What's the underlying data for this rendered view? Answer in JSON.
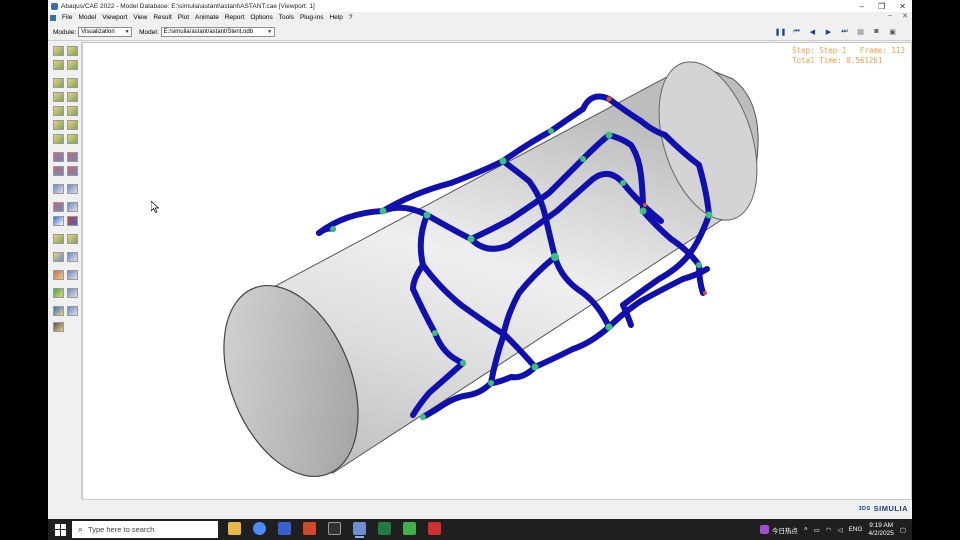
{
  "window": {
    "title": "Abaqus/CAE 2022 - Model Database: E:\\simulia\\astant\\astant\\ASTANT.cae [Viewport: 1]",
    "minimize": "–",
    "maximize": "❐",
    "close": "✕"
  },
  "menu": {
    "items": [
      "File",
      "Model",
      "Viewport",
      "View",
      "Result",
      "Plot",
      "Animate",
      "Report",
      "Options",
      "Tools",
      "Plug-ins",
      "Help",
      "?"
    ],
    "right_min": "–",
    "right_close": "✕"
  },
  "context": {
    "module_label": "Module:",
    "module_value": "Visualization",
    "model_label": "Model:",
    "model_value": "E:/simulia/astant/astant/Stent.odb"
  },
  "animation": {
    "buttons": [
      "pause-icon",
      "first-frame-icon",
      "previous-frame-icon",
      "next-frame-icon",
      "last-frame-icon"
    ],
    "glyphs": [
      "❚❚",
      "⏮",
      "◀",
      "▶",
      "⏭"
    ]
  },
  "viewport_status": {
    "step_line": "Step: Step-1   Frame: 113",
    "time_line": "Total Time: 0.561261"
  },
  "branding": {
    "logo_text": "SIMULIA",
    "logo_symbol": "3DS"
  },
  "taskbar": {
    "search_placeholder": "Type here to search",
    "news_label": "今日热点",
    "lang": "ENG",
    "time": "9:19 AM",
    "date": "4/2/2025",
    "apps": [
      {
        "name": "file-explorer-icon",
        "color": "#e8b84a"
      },
      {
        "name": "chrome-icon",
        "color": "#4c8bf5"
      },
      {
        "name": "app-icon",
        "color": "#3a5fd0"
      },
      {
        "name": "powerpoint-icon",
        "color": "#d04a2a"
      },
      {
        "name": "terminal-icon",
        "color": "#333333"
      },
      {
        "name": "abaqus-icon",
        "color": "#6f8fd0"
      },
      {
        "name": "excel-icon",
        "color": "#1f7a44"
      },
      {
        "name": "green-app-icon",
        "color": "#3fb04a"
      },
      {
        "name": "red-app-icon",
        "color": "#d03030"
      }
    ]
  },
  "colors": {
    "stent_struts": "#1010b0",
    "stent_hot": "#39c27a",
    "status_text": "#f0a040",
    "cylinder_light": "#e8e8e8",
    "cylinder_dark": "#9a9a9a"
  }
}
